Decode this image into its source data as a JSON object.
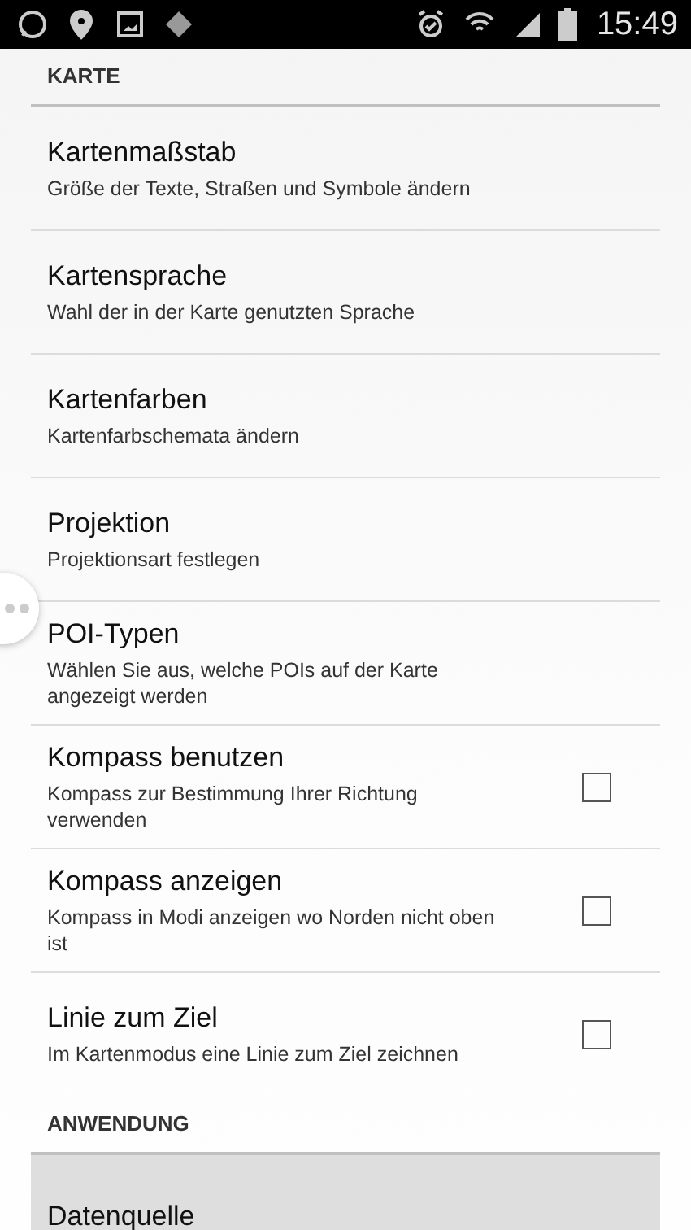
{
  "status_bar": {
    "time": "15:49"
  },
  "sections": [
    {
      "header": "KARTE",
      "items": [
        {
          "kind": "plain",
          "title": "Kartenmaßstab",
          "summary": "Größe der Texte, Straßen und Symbole ändern",
          "selected": false
        },
        {
          "kind": "plain",
          "title": "Kartensprache",
          "summary": "Wahl der in der Karte genutzten Sprache",
          "selected": false
        },
        {
          "kind": "plain",
          "title": "Kartenfarben",
          "summary": "Kartenfarbschemata ändern",
          "selected": false
        },
        {
          "kind": "plain",
          "title": "Projektion",
          "summary": "Projektionsart festlegen",
          "selected": false
        },
        {
          "kind": "plain",
          "title": "POI-Typen",
          "summary": "Wählen Sie aus, welche POIs auf der Karte angezeigt werden",
          "selected": false
        },
        {
          "kind": "checkbox",
          "title": "Kompass benutzen",
          "summary": "Kompass zur Bestimmung Ihrer Richtung verwenden",
          "checked": false,
          "selected": false
        },
        {
          "kind": "checkbox",
          "title": "Kompass anzeigen",
          "summary": "Kompass in Modi anzeigen wo Norden nicht oben ist",
          "checked": false,
          "selected": false
        },
        {
          "kind": "checkbox",
          "title": "Linie zum Ziel",
          "summary": "Im Kartenmodus eine Linie zum Ziel zeichnen",
          "checked": false,
          "selected": false
        }
      ]
    },
    {
      "header": "ANWENDUNG",
      "items": [
        {
          "kind": "plain",
          "title": "Datenquelle",
          "selected": true
        }
      ]
    }
  ]
}
